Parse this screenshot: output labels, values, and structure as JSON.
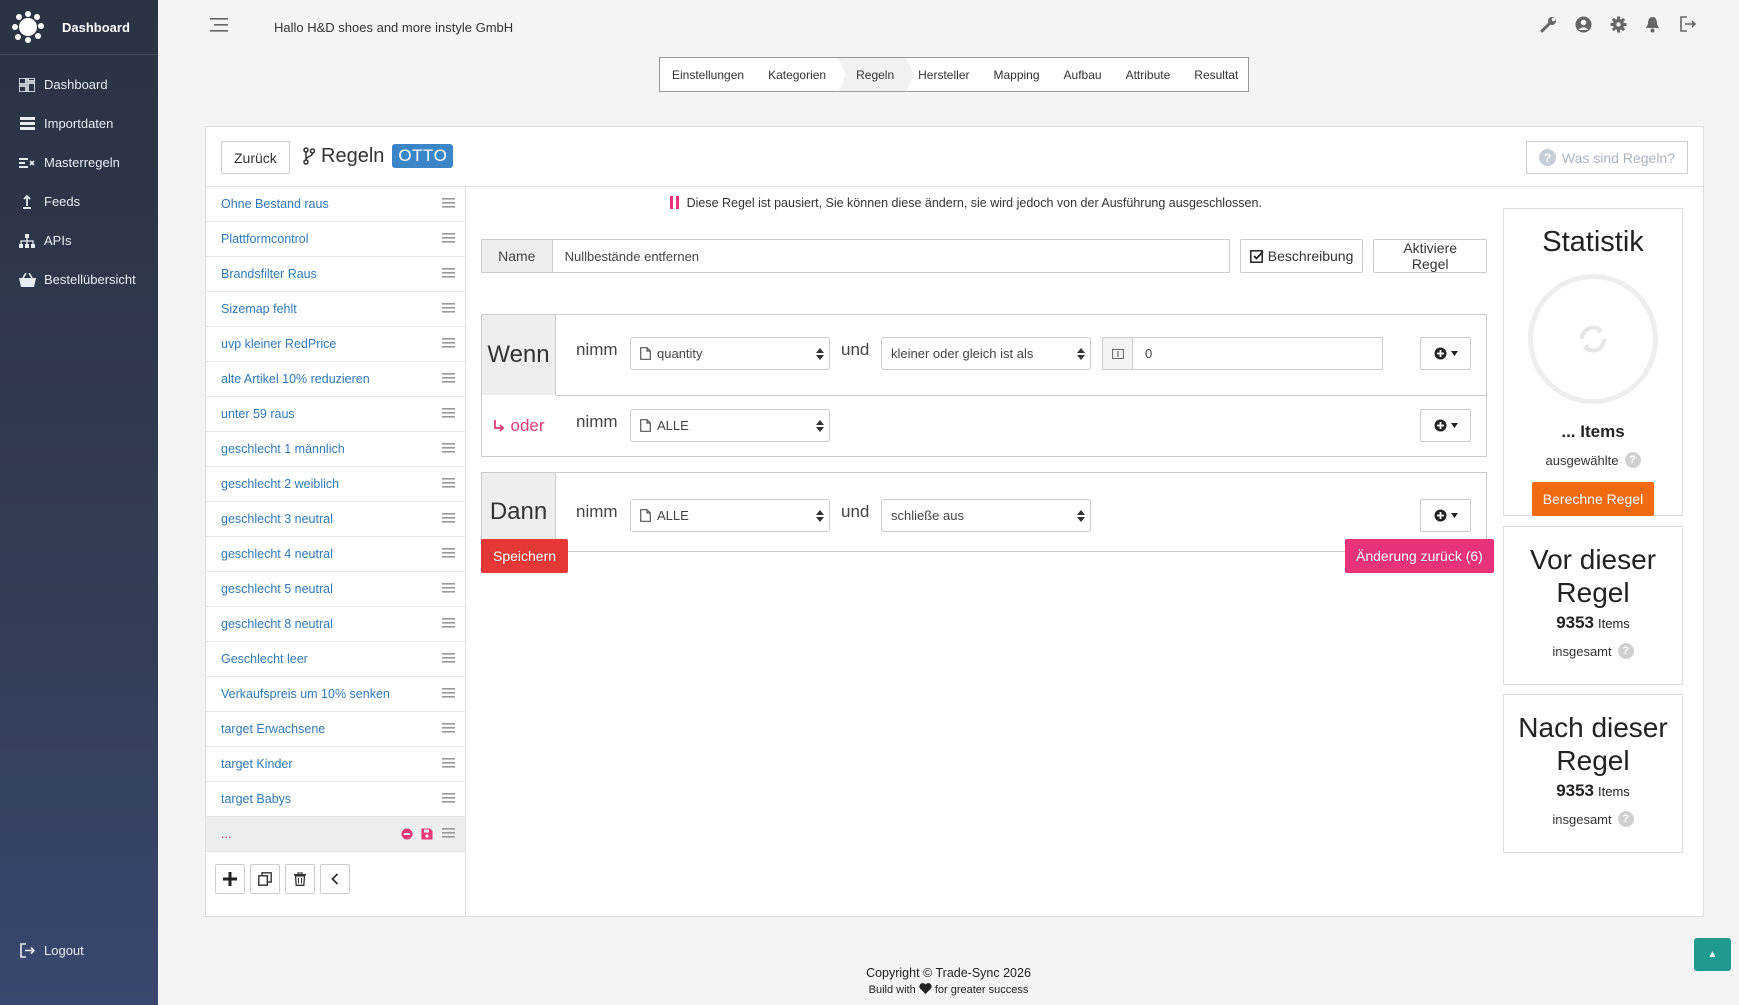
{
  "sidebar": {
    "brand": "Dashboard",
    "items": [
      {
        "label": "Dashboard",
        "icon": "dashboard-icon"
      },
      {
        "label": "Importdaten",
        "icon": "list-icon"
      },
      {
        "label": "Masterregeln",
        "icon": "rules-icon"
      },
      {
        "label": "Feeds",
        "icon": "upload-icon"
      },
      {
        "label": "APIs",
        "icon": "sitemap-icon"
      },
      {
        "label": "Bestellübersicht",
        "icon": "basket-icon"
      }
    ],
    "logout": "Logout"
  },
  "header": {
    "greeting": "Hallo H&D shoes and more instyle GmbH",
    "icons": [
      "wrench-icon",
      "user-icon",
      "gear-icon",
      "bell-icon",
      "signout-icon"
    ]
  },
  "steps": [
    "Einstellungen",
    "Kategorien",
    "Regeln",
    "Hersteller",
    "Mapping",
    "Aufbau",
    "Attribute",
    "Resultat"
  ],
  "active_step": "Regeln",
  "card": {
    "back_label": "Zurück",
    "title": "Regeln",
    "badge": "OTTO",
    "help_label": "Was sind Regeln?"
  },
  "rules_list": [
    "Ohne Bestand raus",
    "Plattformcontrol",
    "Brandsfilter Raus",
    "Sizemap fehlt",
    "uvp kleiner RedPrice",
    "alte Artikel 10% reduzieren",
    "unter 59 raus",
    "geschlecht 1 männlich",
    "geschlecht 2 weiblich",
    "geschlecht 3 neutral",
    "geschlecht 4 neutral",
    "geschlecht 5 neutral",
    "geschlecht 8 neutral",
    "Geschlecht leer",
    "Verkaufspreis um 10% senken",
    "target Erwachsene",
    "target Kinder",
    "target Babys"
  ],
  "selected_rule": "...",
  "editor": {
    "paused_note": "Diese Regel ist pausiert, Sie können diese ändern, sie wird jedoch von der Ausführung ausgeschlossen.",
    "name_label": "Name",
    "name_value": "Nullbestände entfernen",
    "description_label": "Beschreibung",
    "activate_label": "Aktiviere Regel",
    "wenn": {
      "label": "Wenn",
      "take": "nimm",
      "field": "quantity",
      "and": "und",
      "operator": "kleiner oder gleich ist als",
      "value": "0"
    },
    "oder": {
      "label": "oder",
      "take": "nimm",
      "field": "ALLE"
    },
    "dann": {
      "label": "Dann",
      "take": "nimm",
      "field": "ALLE",
      "and": "und",
      "action": "schließe aus"
    },
    "save_label": "Speichern",
    "undo_label": "Änderung zurück (6)"
  },
  "stats": {
    "title": "Statistik",
    "items": "... Items",
    "selected": "ausgewählte",
    "calc_label": "Berechne Regel",
    "before": {
      "title": "Vor dieser Regel",
      "count": "9353",
      "unit": "Items",
      "sub": "insgesamt"
    },
    "after": {
      "title": "Nach dieser Regel",
      "count": "9353",
      "unit": "Items",
      "sub": "insgesamt"
    }
  },
  "footer": {
    "copyright": "Copyright © Trade-Sync 2026",
    "built_pre": "Build with",
    "built_post": "for greater success"
  },
  "to_top": "▲"
}
